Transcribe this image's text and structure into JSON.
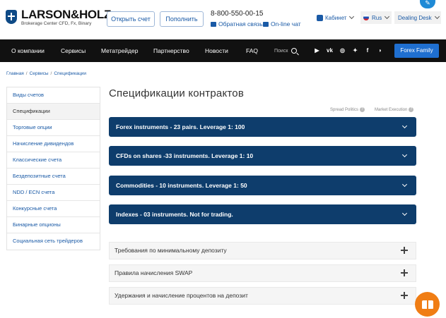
{
  "brand": {
    "name": "LARSON&HOLZ",
    "tagline": "Brokerage Center CFD, Fx, Binary"
  },
  "header": {
    "open_account": "Открыть счет",
    "fund": "Пополнить",
    "phone": "8-800-550-00-15",
    "feedback": "Обратная связь",
    "online_chat": "On-line чат",
    "cabinet": "Кабинет",
    "language": "Rus",
    "dealing_desk": "Dealing Desk"
  },
  "nav": {
    "items": [
      "О компании",
      "Сервисы",
      "Метатрейдер",
      "Партнерство",
      "Новости",
      "FAQ"
    ],
    "search_placeholder": "Поиск",
    "social": [
      "youtube-icon",
      "vk-icon",
      "instagram-icon",
      "twitter-icon",
      "facebook-icon",
      "rss-icon"
    ],
    "family_button": "Forex Family"
  },
  "breadcrumb": [
    "Главная",
    "Сервисы",
    "Спецификации"
  ],
  "sidebar": {
    "items": [
      "Виды счетов",
      "Спецификации",
      "Торговые опции",
      "Начисление дивидендов",
      "Классические счета",
      "Бездепозитные счета",
      "NDD / ECN счета",
      "Конкурсные счета",
      "Бинарные опционы",
      "Социальная сеть трейдеров"
    ],
    "active_index": 1
  },
  "main": {
    "title": "Спецификации контрактов",
    "spread_politics": "Spread Politics",
    "market_execution": "Market Execution",
    "instruments": [
      "Forex instruments - 23 pairs. Leverage 1: 100",
      "CFDs on shares -33 instruments. Leverage 1: 10",
      "Commodities - 10 instruments. Leverage 1: 50",
      "Indexes - 03 instruments. Not for trading."
    ],
    "info_sections": [
      "Требования по минимальному депозиту",
      "Правила начисления SWAP",
      "Удержания и начисление процентов на депозит"
    ]
  },
  "colors": {
    "accent": "#0e3d6c",
    "link": "#1a5aa6",
    "nav_bg": "#111111",
    "fab": "#f07d14"
  }
}
